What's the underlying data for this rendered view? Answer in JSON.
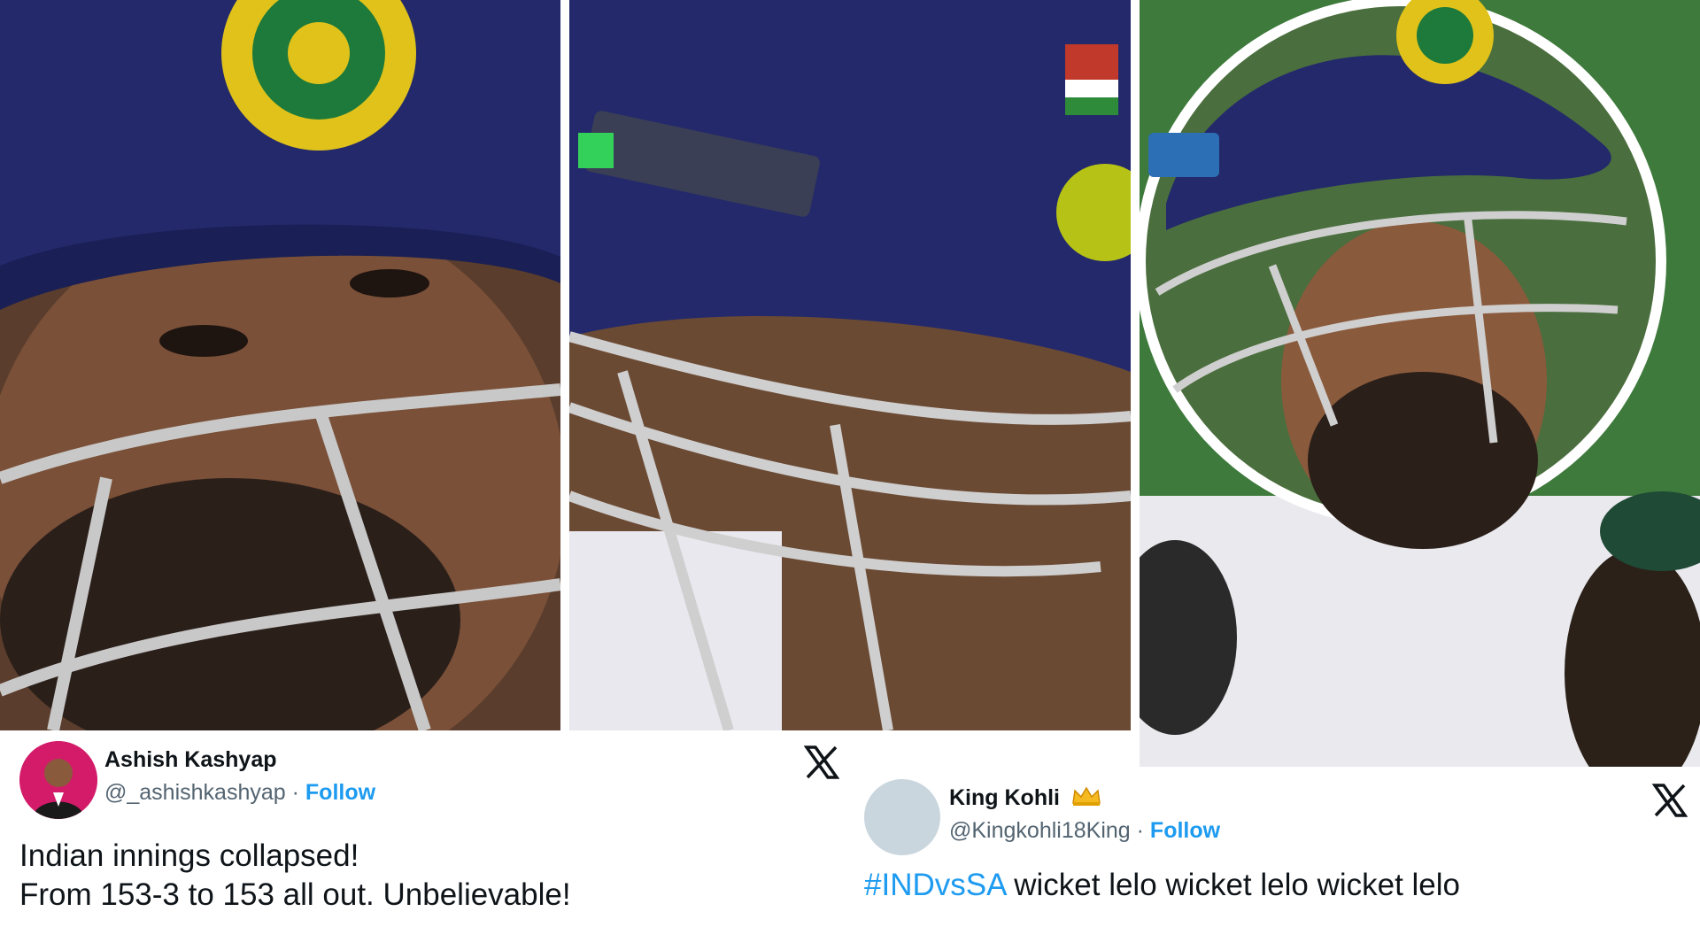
{
  "tweets": [
    {
      "author_name": "Ashish Kashyap",
      "handle": "@_ashishkashyap",
      "separator": "·",
      "follow_label": "Follow",
      "text_lines": [
        "Indian innings collapsed!",
        "From 153-3 to 153 all out. Unbelievable!"
      ],
      "platform_icon": "x-logo-icon"
    },
    {
      "author_name": "King Kohli",
      "name_emoji_icon": "crown-icon",
      "handle": "@Kingkohli18King",
      "separator": "·",
      "follow_label": "Follow",
      "hashtag": "#INDvsSA",
      "text": " wicket lelo wicket lelo wicket lelo",
      "platform_icon": "x-logo-icon"
    }
  ],
  "colors": {
    "link_blue": "#1d9bf0",
    "text_primary": "#0f1419",
    "text_secondary": "#536471",
    "helmet_navy": "#23296b"
  }
}
